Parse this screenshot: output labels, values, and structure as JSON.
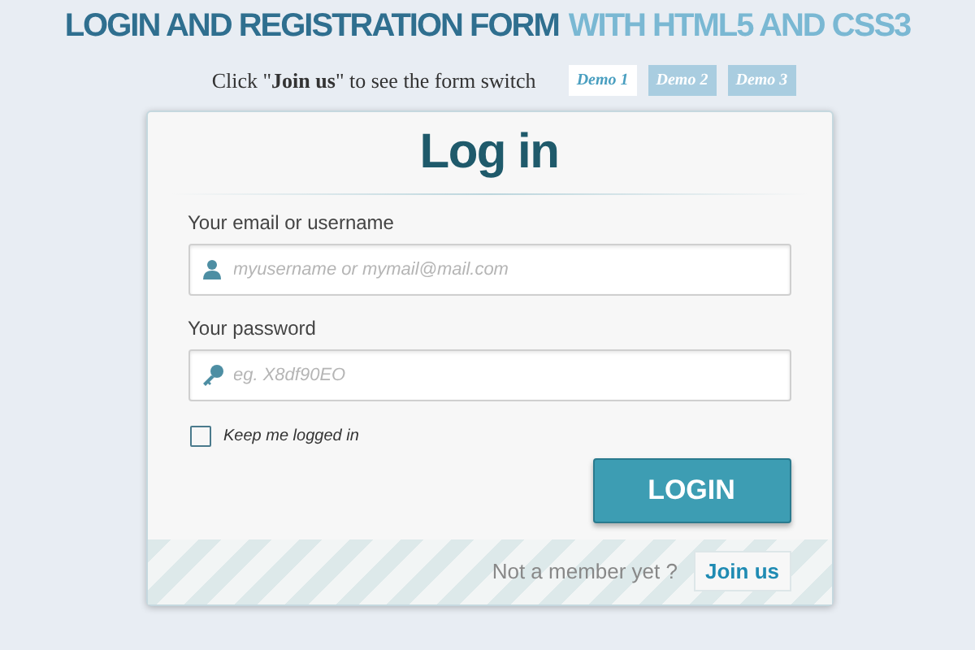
{
  "header": {
    "title_main": "LOGIN AND REGISTRATION FORM",
    "title_accent": "WITH HTML5 AND CSS3"
  },
  "intro": "Click \"**Join us**\" to see the form switch",
  "demos": [
    {
      "label": "Demo 1",
      "selected": true
    },
    {
      "label": "Demo 2",
      "selected": false
    },
    {
      "label": "Demo 3",
      "selected": false
    }
  ],
  "form": {
    "title": "Log in",
    "fields": [
      {
        "kind": "user",
        "label": "Your email or username",
        "placeholder": "myusername or mymail@mail.com"
      },
      {
        "kind": "key",
        "label": "Your password",
        "placeholder": "eg. X8df90EO"
      }
    ],
    "remember": {
      "label": "Keep me logged in",
      "checked": false
    },
    "submit": "LOGIN",
    "footer_text": "Not a member yet ?",
    "footer_link": "Join us"
  }
}
